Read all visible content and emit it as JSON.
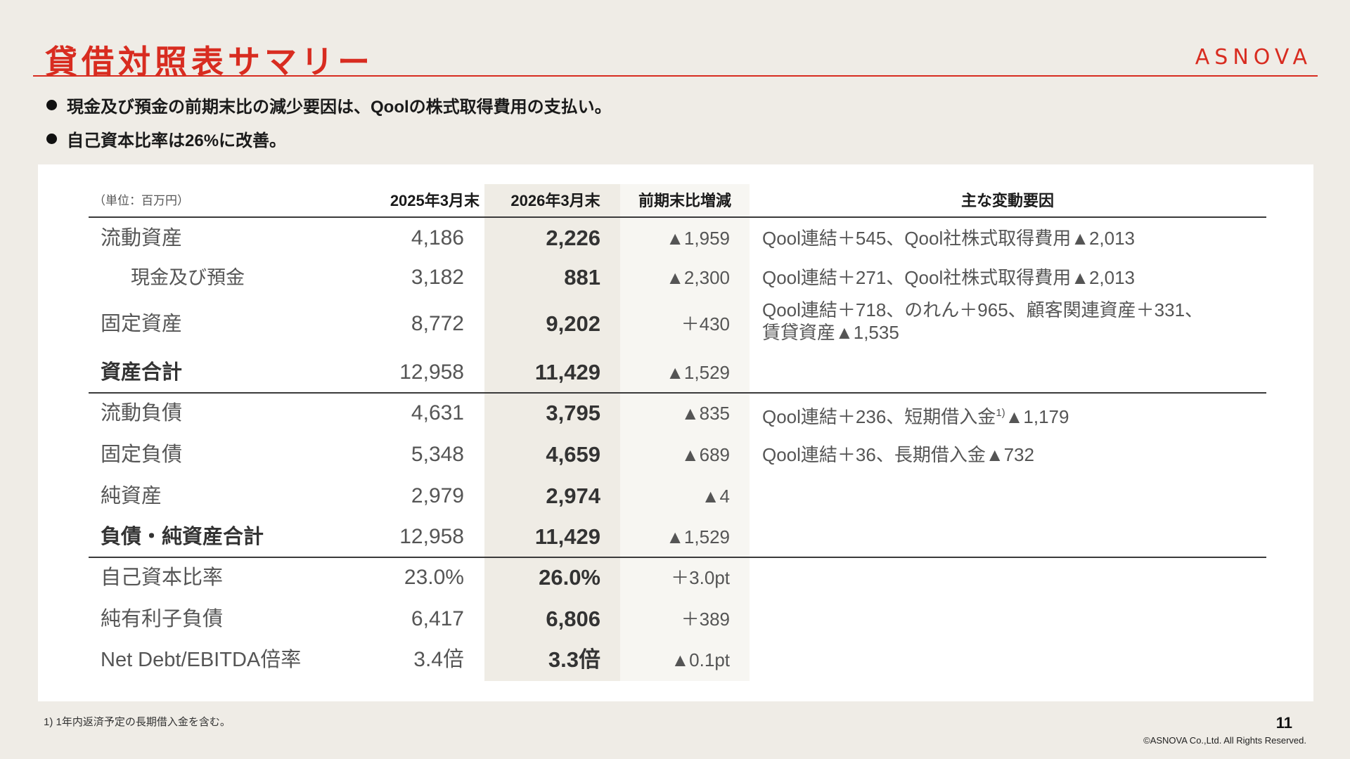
{
  "header": {
    "title": "貸借対照表サマリー",
    "logo": "ASNOVA"
  },
  "bullets": [
    "現金及び預金の前期末比の減少要因は、Qoolの株式取得費用の支払い。",
    "自己資本比率は26%に改善。"
  ],
  "table": {
    "unit": "（単位：百万円）",
    "columns": [
      "2025年3月末",
      "2026年3月末",
      "前期末比増減",
      "主な変動要因"
    ],
    "rows": [
      {
        "label": "流動資産",
        "v1": "4,186",
        "v2": "2,226",
        "v3": "▲1,959",
        "note": "Qool連結＋545、Qool社株式取得費用▲2,013"
      },
      {
        "label": "現金及び預金",
        "v1": "3,182",
        "v2": "881",
        "v3": "▲2,300",
        "note": "Qool連結＋271、Qool社株式取得費用▲2,013"
      },
      {
        "label": "固定資産",
        "v1": "8,772",
        "v2": "9,202",
        "v3": "＋430",
        "note": "Qool連結＋718、のれん＋965、顧客関連資産＋331、",
        "note2": "賃貸資産▲1,535"
      },
      {
        "label": "資産合計",
        "v1": "12,958",
        "v2": "11,429",
        "v3": "▲1,529",
        "note": ""
      },
      {
        "label": "流動負債",
        "v1": "4,631",
        "v2": "3,795",
        "v3": "▲835",
        "note": "Qool連結＋236、短期借入金",
        "note_sup": "1)",
        "note_tail": "▲1,179"
      },
      {
        "label": "固定負債",
        "v1": "5,348",
        "v2": "4,659",
        "v3": "▲689",
        "note": "Qool連結＋36、長期借入金▲732"
      },
      {
        "label": "純資産",
        "v1": "2,979",
        "v2": "2,974",
        "v3": "▲4",
        "note": ""
      },
      {
        "label": "負債・純資産合計",
        "v1": "12,958",
        "v2": "11,429",
        "v3": "▲1,529",
        "note": ""
      },
      {
        "label": "自己資本比率",
        "v1": "23.0%",
        "v2": "26.0%",
        "v3": "＋3.0pt",
        "note": ""
      },
      {
        "label": "純有利子負債",
        "v1": "6,417",
        "v2": "6,806",
        "v3": "＋389",
        "note": ""
      },
      {
        "label": "Net Debt/EBITDA倍率",
        "v1": "3.4倍",
        "v2": "3.3倍",
        "v3": "▲0.1pt",
        "note": ""
      }
    ]
  },
  "footer": {
    "footnote": "1) 1年内返済予定の長期借入金を含む。",
    "page": "11",
    "copyright": "©ASNOVA Co.,Ltd. All Rights Reserved."
  }
}
